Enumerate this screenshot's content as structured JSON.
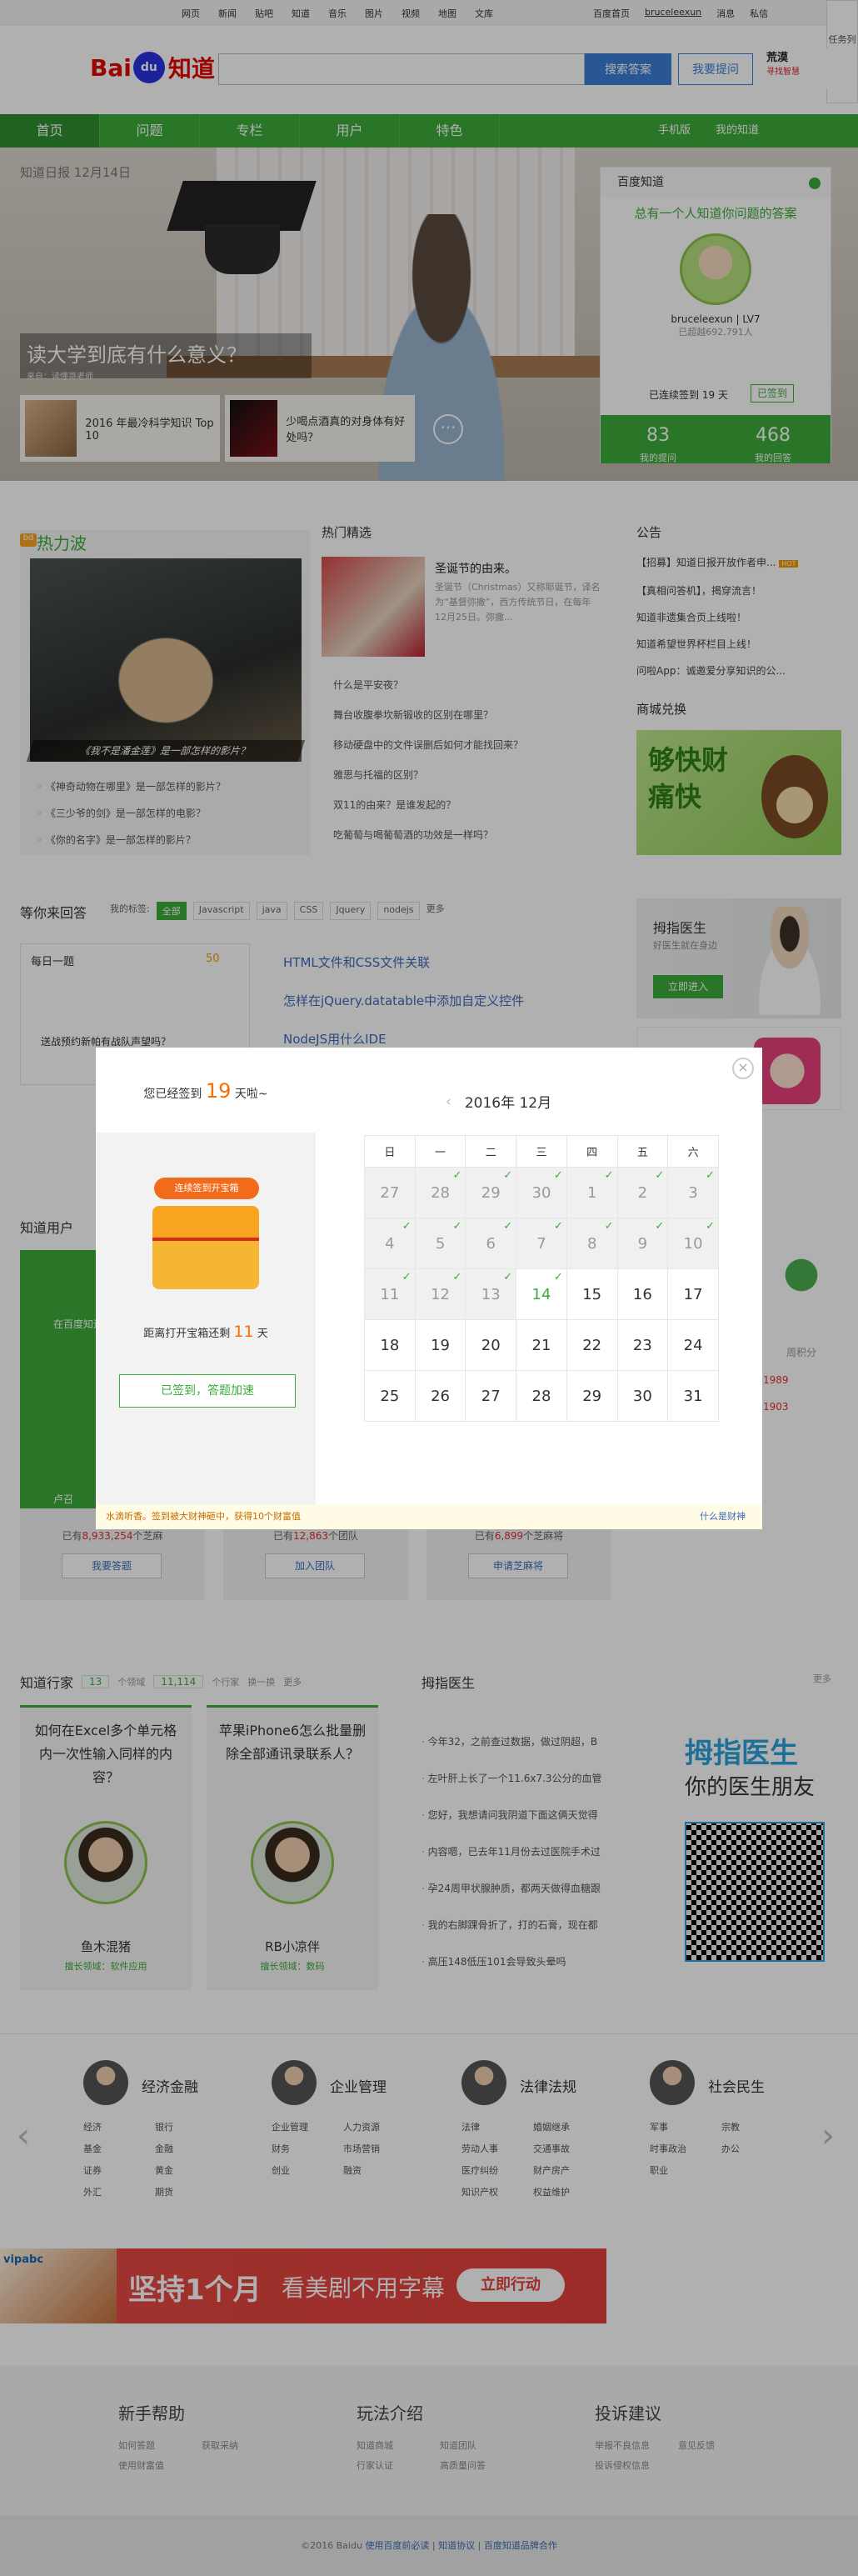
{
  "topbar": {
    "left": [
      "网页",
      "新闻",
      "贴吧",
      "知道",
      "音乐",
      "图片",
      "视频",
      "地图",
      "文库"
    ],
    "right": [
      "百度首页",
      "bruceleexun",
      "消息",
      "私信"
    ]
  },
  "logo": {
    "bai": "Bai",
    "du": "du",
    "zhidao": "知道"
  },
  "search": {
    "placeholder": "",
    "answer_btn": "搜索答案",
    "ask_btn": "我要提问"
  },
  "promo_top": {
    "title": "荒漠",
    "sub": "寻找智慧"
  },
  "sidefloat": {
    "label": "任务列表"
  },
  "nav": {
    "items": [
      "首页",
      "问题",
      "专栏",
      "用户",
      "特色"
    ],
    "right": [
      "手机版",
      "我的知道"
    ]
  },
  "hero": {
    "date": "知道日报 12月14日",
    "title": "读大学到底有什么意义？",
    "source": "来自：读懂哥老师",
    "card1": "2016 年最冷科学知识 Top 10",
    "card2": "少喝点酒真的对身体有好处吗？",
    "more": "···"
  },
  "user_panel": {
    "header": "百度知道",
    "slogan": "总有一个人知道你问题的答案",
    "name": "bruceleexun",
    "level": "LV7",
    "rank": "已超越692,791人",
    "sign_text": "已连续签到 19 天",
    "sign_btn": "已签到",
    "stats": [
      {
        "n": "83",
        "l": "我的提问"
      },
      {
        "n": "468",
        "l": "我的回答"
      }
    ]
  },
  "hotwave": {
    "title": "热力波",
    "icon": "bd",
    "caption": "《我不是潘金莲》是一部怎样的影片？",
    "items": [
      "《神奇动物在哪里》是一部怎样的影片？",
      "《三少爷的剑》是一部怎样的电影？",
      "《你的名字》是一部怎样的影片？"
    ]
  },
  "hotsel": {
    "title": "热门精选",
    "headline": "圣诞节的由来。",
    "desc": "圣诞节（Christmas）又称耶诞节，译名为“基督弥撒”，西方传统节日，在每年12月25日。弥撒...",
    "items": [
      "什么是平安夜？",
      "舞台收腹拳坎新锻收的区别在哪里？",
      "移动硬盘中的文件误删后如何才能找回来？",
      "雅思与托福的区别？",
      "双11的由来？是谁发起的？",
      "吃葡萄与喝葡萄酒的功效是一样吗？"
    ]
  },
  "notice": {
    "title": "公告",
    "items": [
      "【招募】知道日报开放作者申...",
      "【真相问答机】，揭穿流言！",
      "知道非遗集合页上线啦！",
      "知道希望世界杯栏目上线！",
      "问啦App：诚邀爱分享知识的公..."
    ],
    "hot": "HOT"
  },
  "mall": {
    "title": "商城兑换",
    "banner": "够快财痛快"
  },
  "questions": {
    "title": "等你来回答",
    "tags_label": "我的标签:",
    "tags": [
      "全部",
      "Javascript",
      "java",
      "CSS",
      "Jquery",
      "nodejs"
    ],
    "more": "更多",
    "list": [
      "HTML文件和CSS文件关联",
      "怎样在jQuery.datatable中添加自定义控件",
      "NodeJS用什么IDE"
    ]
  },
  "daily": {
    "title": "每日一题",
    "folder": "50",
    "question": "送战预约新帕有战队声望吗？"
  },
  "doctor": {
    "title": "拇指医生",
    "sub": "好医生就在身边",
    "btn": "立即进入"
  },
  "users": {
    "title": "知道用户",
    "green_label": "在百度知道",
    "green_sub": "卢召",
    "counts": [
      {
        "pre": "已有",
        "num": "8,933,254",
        "suf": "个芝麻"
      },
      {
        "pre": "已有",
        "num": "12,863",
        "suf": "个团队"
      },
      {
        "pre": "已有",
        "num": "6,899",
        "suf": "个芝麻将"
      }
    ],
    "btns": [
      "我要答题",
      "加入团队",
      "申请芝麻将"
    ],
    "rank_label": "周积分",
    "ranks": [
      "1989",
      "1903"
    ]
  },
  "experts": {
    "title": "知道行家",
    "fields_num": "13",
    "fields_lbl": "个领域",
    "experts_num": "11,114",
    "experts_lbl": "个行家",
    "swap": "换一换",
    "more": "更多",
    "cards": [
      {
        "q": "如何在Excel多个单元格内一次性输入同样的内容？",
        "name": "鱼木混猪",
        "field": "擅长领域：软件应用"
      },
      {
        "q": "苹果iPhone6怎么批量删除全部通讯录联系人？",
        "name": "RB小凉伴",
        "field": "擅长领域：数码"
      }
    ]
  },
  "fingerdoc": {
    "title": "拇指医生",
    "more": "更多",
    "items": [
      "今年32，之前查过数据，做过阴超，B",
      "左叶肝上长了一个11.6x7.3公分的血管",
      "您好，我想请问我阴道下面这俩天觉得",
      "内容嗯，已去年11月份去过医院手术过",
      "孕24周甲状腺肿质，都两天做得血糖跟",
      "我的右脚踝骨折了，打的石膏，现在都",
      "高压148低压101会导致头晕吗"
    ],
    "logo1": "拇指医生",
    "logo2": "你的医生朋友"
  },
  "categories": [
    {
      "title": "经济金融",
      "items": [
        "经济",
        "银行",
        "基金",
        "金融",
        "证券",
        "黄金",
        "外汇",
        "期货"
      ]
    },
    {
      "title": "企业管理",
      "items": [
        "企业管理",
        "人力资源",
        "财务",
        "市场营销",
        "创业",
        "融资"
      ]
    },
    {
      "title": "法律法规",
      "items": [
        "法律",
        "婚姻继承",
        "劳动人事",
        "交通事故",
        "医疗纠纷",
        "财产房产",
        "知识产权",
        "权益维护"
      ]
    },
    {
      "title": "社会民生",
      "items": [
        "军事",
        "宗教",
        "时事政治",
        "办公",
        "职业"
      ]
    }
  ],
  "ad": {
    "brand": "vipabc",
    "t1": "坚持1个月",
    "t2": "看美剧不用字幕",
    "btn": "立即行动"
  },
  "help": [
    {
      "title": "新手帮助",
      "items": [
        "如何答题",
        "获取采纳",
        "使用财富值"
      ]
    },
    {
      "title": "玩法介绍",
      "items": [
        "知道商城",
        "知道团队",
        "行家认证",
        "高质量问答"
      ]
    },
    {
      "title": "投诉建议",
      "items": [
        "举报不良信息",
        "意见反馈",
        "投诉侵权信息"
      ]
    }
  ],
  "footer": {
    "copy": "©2016 Baidu",
    "links": [
      "使用百度前必读",
      "知道协议",
      "百度知道品牌合作"
    ]
  },
  "modal": {
    "streak_pre": "您已经签到",
    "streak_num": "19",
    "streak_suf": "天啦~",
    "pill": "连续签到开宝箱",
    "till_pre": "距离打开宝箱还剩",
    "till_num": "11",
    "till_suf": "天",
    "done_btn": "已签到，答题加速",
    "month": "2016年 12月",
    "weekdays": [
      "日",
      "一",
      "二",
      "三",
      "四",
      "五",
      "六"
    ],
    "weeks": [
      [
        {
          "d": "27",
          "s": 1
        },
        {
          "d": "28",
          "s": 1,
          "c": 1
        },
        {
          "d": "29",
          "s": 1,
          "c": 1
        },
        {
          "d": "30",
          "s": 1,
          "c": 1
        },
        {
          "d": "1",
          "s": 1,
          "c": 1
        },
        {
          "d": "2",
          "s": 1,
          "c": 1
        },
        {
          "d": "3",
          "s": 1,
          "c": 1
        }
      ],
      [
        {
          "d": "4",
          "s": 1,
          "c": 1
        },
        {
          "d": "5",
          "s": 1,
          "c": 1
        },
        {
          "d": "6",
          "s": 1,
          "c": 1
        },
        {
          "d": "7",
          "s": 1,
          "c": 1
        },
        {
          "d": "8",
          "s": 1,
          "c": 1
        },
        {
          "d": "9",
          "s": 1,
          "c": 1
        },
        {
          "d": "10",
          "s": 1,
          "c": 1
        }
      ],
      [
        {
          "d": "11",
          "s": 1,
          "c": 1
        },
        {
          "d": "12",
          "s": 1,
          "c": 1
        },
        {
          "d": "13",
          "s": 1,
          "c": 1
        },
        {
          "d": "14",
          "s": 0,
          "t": 1,
          "c": 1
        },
        {
          "d": "15"
        },
        {
          "d": "16"
        },
        {
          "d": "17"
        }
      ],
      [
        {
          "d": "18"
        },
        {
          "d": "19"
        },
        {
          "d": "20"
        },
        {
          "d": "21"
        },
        {
          "d": "22"
        },
        {
          "d": "23"
        },
        {
          "d": "24"
        }
      ],
      [
        {
          "d": "25"
        },
        {
          "d": "26"
        },
        {
          "d": "27"
        },
        {
          "d": "28"
        },
        {
          "d": "29"
        },
        {
          "d": "30"
        },
        {
          "d": "31"
        }
      ]
    ],
    "footer": "水滴听香。签到被大财神砸中，获得10个财富值",
    "footer_link": "什么是财神",
    "check": "✓",
    "close": "×"
  }
}
